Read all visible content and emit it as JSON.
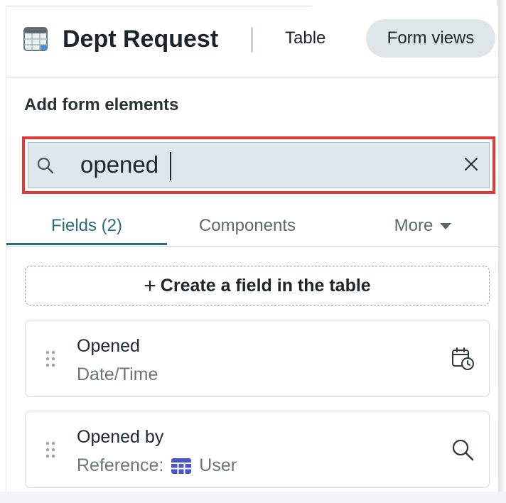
{
  "header": {
    "app_title": "Dept Request",
    "nav": {
      "table_label": "Table",
      "form_views_label": "Form views"
    }
  },
  "panel": {
    "section_title": "Add form elements",
    "search": {
      "value": "opened",
      "placeholder": ""
    },
    "tabs": [
      {
        "label": "Fields (2)",
        "active": true
      },
      {
        "label": "Components",
        "active": false
      },
      {
        "label": "More",
        "active": false
      }
    ],
    "create_field_label": "Create a field in the table",
    "fields": [
      {
        "name": "Opened",
        "type": "Date/Time",
        "icon": "calendar-clock-icon"
      },
      {
        "name": "Opened by",
        "type_prefix": "Reference:",
        "reference_table": "User",
        "icon": "search-icon"
      }
    ]
  },
  "colors": {
    "accent": "#2b6b7a",
    "highlight": "#e53935",
    "search_bg": "#dde8ec",
    "pill_bg": "#dfe6ea",
    "reference_icon": "#4a55c9"
  }
}
